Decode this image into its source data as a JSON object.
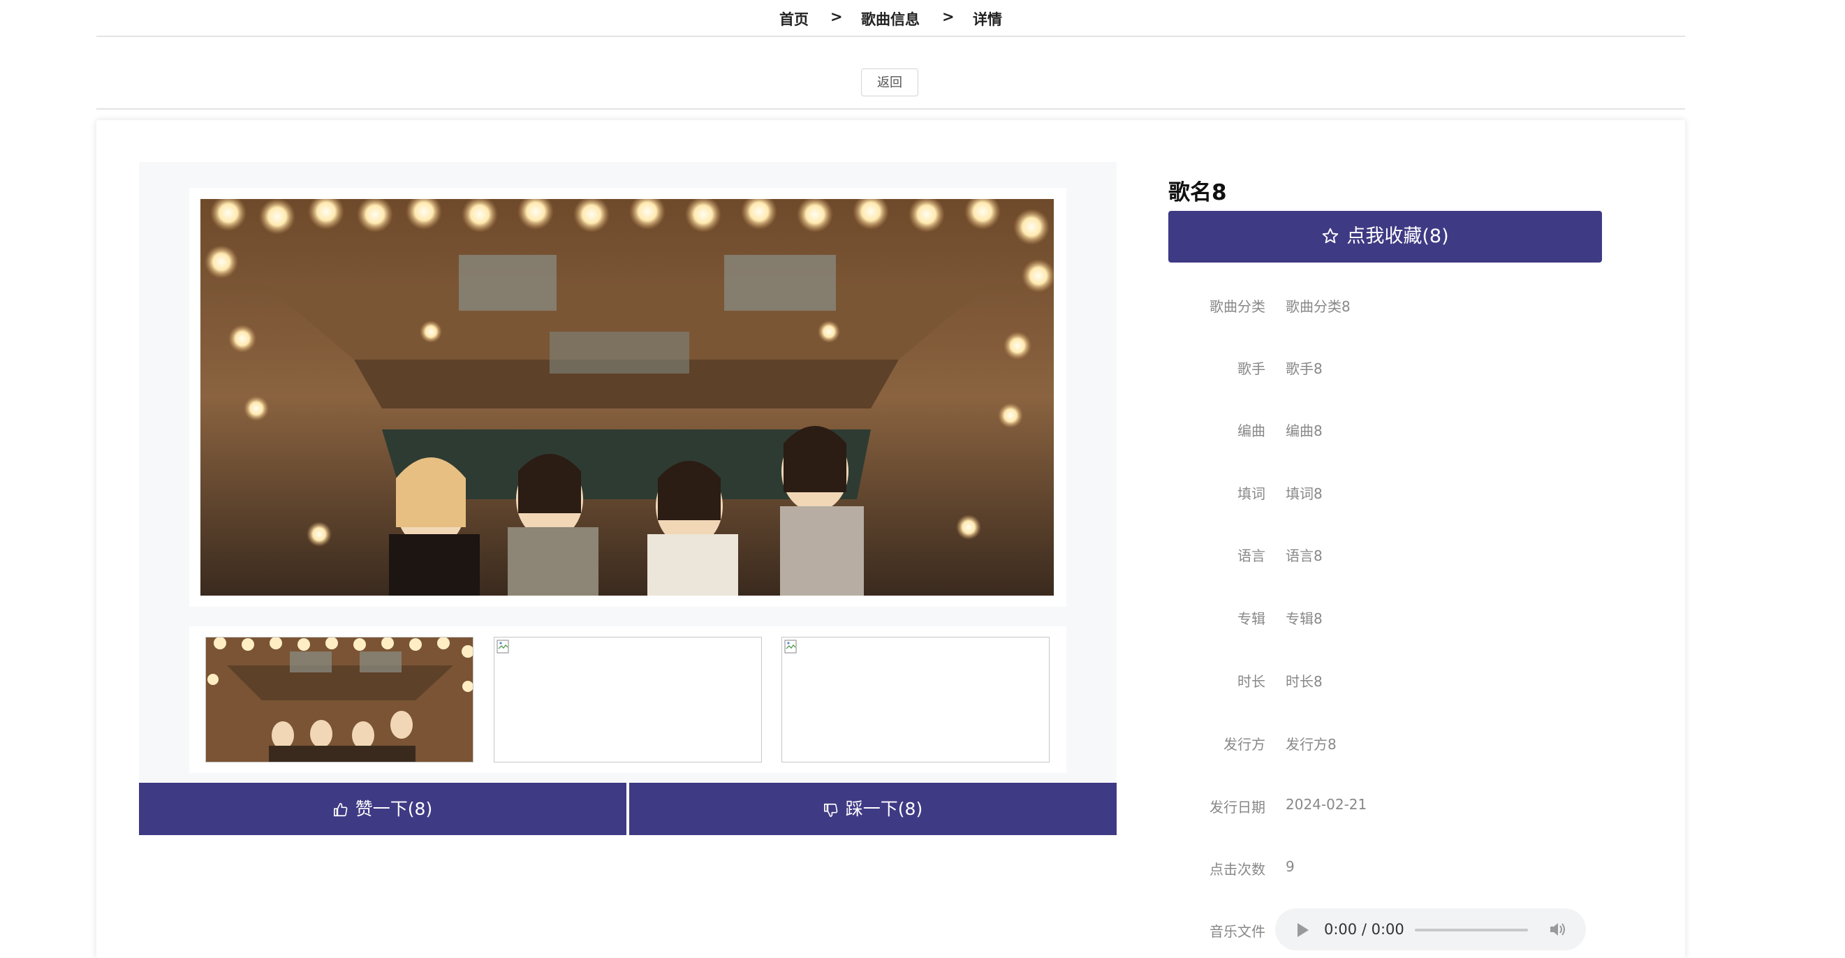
{
  "breadcrumb": {
    "home": "首页",
    "sep1": ">",
    "section": "歌曲信息",
    "sep2": ">",
    "current": "详情"
  },
  "back_button": "返回",
  "gallery": {
    "main_image": "group-photo",
    "thumbnails": [
      "group-photo",
      "broken-image",
      "broken-image"
    ]
  },
  "votes": {
    "like_label": "赞一下(8)",
    "dislike_label": "踩一下(8)"
  },
  "song": {
    "title": "歌名8",
    "favorite_label": "点我收藏(8)",
    "fields": [
      {
        "label": "歌曲分类",
        "value": "歌曲分类8"
      },
      {
        "label": "歌手",
        "value": "歌手8"
      },
      {
        "label": "编曲",
        "value": "编曲8"
      },
      {
        "label": "填词",
        "value": "填词8"
      },
      {
        "label": "语言",
        "value": "语言8"
      },
      {
        "label": "专辑",
        "value": "专辑8"
      },
      {
        "label": "时长",
        "value": "时长8"
      },
      {
        "label": "发行方",
        "value": "发行方8"
      },
      {
        "label": "发行日期",
        "value": "2024-02-21"
      },
      {
        "label": "点击次数",
        "value": "9"
      }
    ],
    "music_label": "音乐文件",
    "audio_time": "0:00 / 0:00"
  },
  "colors": {
    "accent": "#3f3a84"
  }
}
